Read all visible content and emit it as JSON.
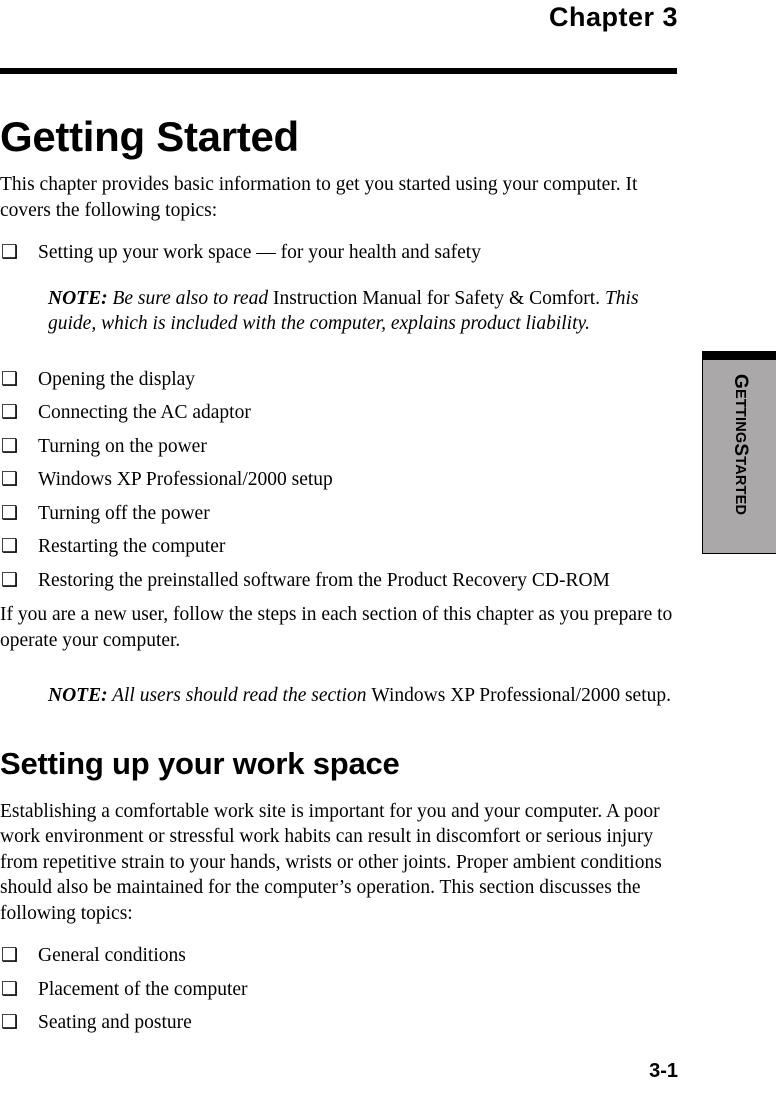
{
  "header": {
    "chapter_label": "Chapter  3"
  },
  "title": "Getting Started",
  "intro": {
    "paragraph": "This chapter provides basic information to get you started using your computer. It covers the following topics:"
  },
  "topics_list_1": [
    {
      "bullet": "❑",
      "label": "Setting up your work space — for your health and safety"
    }
  ],
  "note_1": {
    "label": "NOTE:",
    "italic_1": " Be sure also to read ",
    "roman_1": "Instruction Manual for Safety & Comfort.",
    "italic_2": " This guide, which is included with the computer, explains product liability."
  },
  "topics_list_2": [
    {
      "bullet": "❑",
      "label": "Opening the display"
    },
    {
      "bullet": "❑",
      "label": "Connecting the AC adaptor"
    },
    {
      "bullet": "❑",
      "label": "Turning on the power"
    },
    {
      "bullet": "❑",
      "label": "Windows XP Professional/2000 setup"
    },
    {
      "bullet": "❑",
      "label": "Turning off the power"
    },
    {
      "bullet": "❑",
      "label": "Restarting the computer"
    },
    {
      "bullet": "❑",
      "label": "Restoring the preinstalled software from the Product Recovery CD-ROM"
    }
  ],
  "new_user": {
    "paragraph": "If you are a new user, follow the steps in each section of this chapter as you prepare to operate your computer."
  },
  "note_2": {
    "label": "NOTE:",
    "italic_1": " All users should read the section ",
    "roman_1": "Windows XP Professional/2000 setup."
  },
  "section": {
    "heading": "Setting up your work space",
    "paragraph": "Establishing a comfortable work site is important for you and your computer. A poor work environment or stressful work habits can result in discomfort or serious injury from repetitive strain to your hands, wrists or other joints. Proper ambient conditions should also be maintained for the computer’s operation. This section discusses the following topics:"
  },
  "topics_list_3": [
    {
      "bullet": "❑",
      "label": "General conditions"
    },
    {
      "bullet": "❑",
      "label": "Placement of the computer"
    },
    {
      "bullet": "❑",
      "label": "Seating and posture"
    }
  ],
  "side_tab": {
    "text_parts": [
      {
        "text": "G",
        "size": "cap"
      },
      {
        "text": "ETTING",
        "size": "sc"
      },
      {
        "text": " S",
        "size": "cap"
      },
      {
        "text": "TARTED",
        "size": "sc"
      }
    ],
    "background_color": "#aaa8a8",
    "cap_color": "#000000"
  },
  "footer": {
    "page_number": "3-1"
  }
}
